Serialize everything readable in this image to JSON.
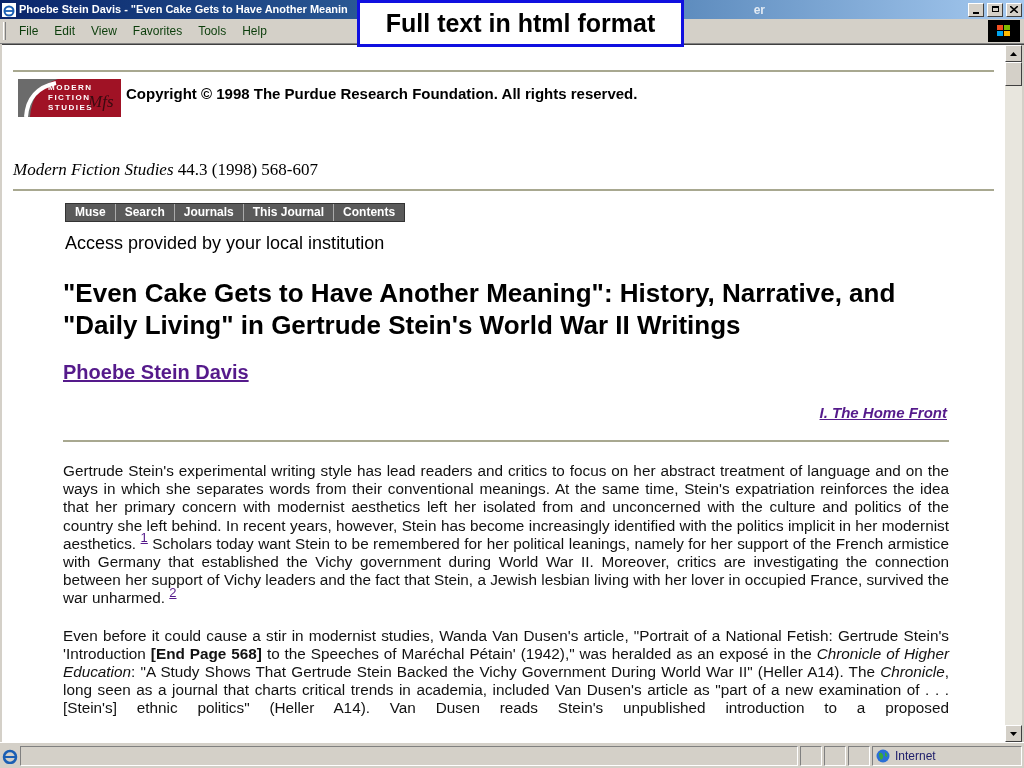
{
  "window": {
    "title_start": "Phoebe Stein Davis - \"Even Cake Gets to Have Another Meanin",
    "title_end": "er"
  },
  "overlay_label": "Full text in html format",
  "menu": [
    "File",
    "Edit",
    "View",
    "Favorites",
    "Tools",
    "Help"
  ],
  "logo": {
    "lines": [
      "MODERN",
      "FICTION",
      "STUDIES"
    ],
    "mark": "Mfs"
  },
  "copyright": "Copyright © 1998 The Purdue Research Foundation. All rights reserved.",
  "citation": {
    "journal": "Modern Fiction Studies",
    "issue": "44.3 (1998) 568-607"
  },
  "nav": [
    "Muse",
    "Search",
    "Journals",
    "This Journal",
    "Contents"
  ],
  "access": "Access provided by your local institution",
  "article_title": "\"Even Cake Gets to Have Another Meaning\": History, Narrative, and \"Daily Living\" in Gertrude Stein's World War II Writings",
  "author": "Phoebe Stein Davis",
  "section_link": "I. The Home Front",
  "paragraphs": [
    "Gertrude Stein's experimental writing style has lead readers and critics to focus on her abstract treatment of language and on the ways in which she separates words from their conventional meanings. At the same time, Stein's expatriation reinforces the idea that her primary concern with modernist aesthetics left her isolated from and unconcerned with the culture and politics of the country she left behind. In recent years, however, Stein has become increasingly identified with the politics implicit in her modernist aesthetics. $^{1}$ Scholars today want Stein to be remembered for her political leanings, namely for her support of the French armistice with Germany that established the Vichy government during World War II. Moreover, critics are investigating the connection between her support of Vichy leaders and the fact that Stein, a Jewish lesbian living with her lover in occupied France, survived the war unharmed. $^{2}$",
    "Even before it could cause a stir in modernist studies, Wanda Van Dusen's article, \"Portrait of a National Fetish: Gertrude Stein's 'Introduction **[End Page 568]** to the Speeches of Maréchal Pétain' (1942),\" was heralded as an exposé in the *Chronicle of Higher Education*: \"A Study Shows That Gertrude Stein Backed the Vichy Government During World War II\" (Heller A14). The *Chronicle*, long seen as a journal that charts critical trends in academia, included Van Dusen's article as \"part of a new examination of . . . [Stein's] ethnic politics\" (Heller A14). Van Dusen reads Stein's unpublished introduction to a proposed"
  ],
  "status_bar": {
    "zone": "Internet"
  }
}
